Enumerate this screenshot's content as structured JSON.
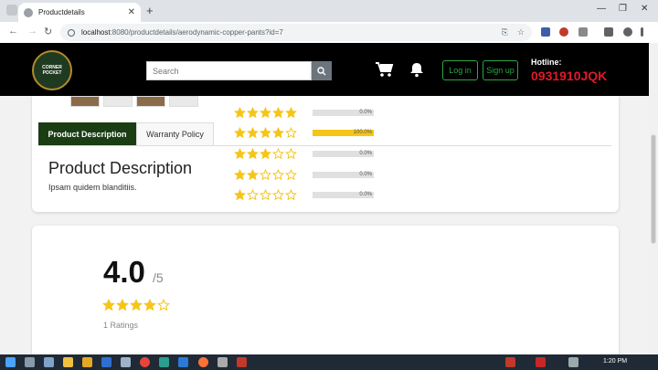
{
  "browser": {
    "tab_title": "Productdetails",
    "new_tab_glyph": "+",
    "url_host": "localhost",
    "url_path": ":8080/productdetails/aerodynamic-copper-pants?id=7"
  },
  "header": {
    "logo_line1": "CORNER",
    "logo_line2": "POCKET",
    "search_placeholder": "Search",
    "login_label": "Log in",
    "signup_label": "Sign up",
    "hotline_label": "Hotline:",
    "hotline_number": "0931910JQK",
    "accent_color": "#28a745",
    "hotline_color": "#e0192a"
  },
  "product_tabs": {
    "active": "Product Description",
    "inactive": "Warranty Policy",
    "active_color": "#1a3d14"
  },
  "description": {
    "heading": "Product Description",
    "text": "Ipsam quidem blanditiis."
  },
  "rating": {
    "average": "4.0",
    "out_of": "/5",
    "count_text": "1 Ratings",
    "star_color": "#f5c518",
    "average_stars_filled": 4,
    "rows": [
      {
        "stars": 5,
        "percent_text": "0.0%",
        "fraction": 0.0
      },
      {
        "stars": 4,
        "percent_text": "100.0%",
        "fraction": 1.0
      },
      {
        "stars": 3,
        "percent_text": "0.0%",
        "fraction": 0.0
      },
      {
        "stars": 2,
        "percent_text": "0.0%",
        "fraction": 0.0
      },
      {
        "stars": 1,
        "percent_text": "0.0%",
        "fraction": 0.0
      }
    ]
  },
  "taskbar": {
    "time": "1:20 PM"
  }
}
